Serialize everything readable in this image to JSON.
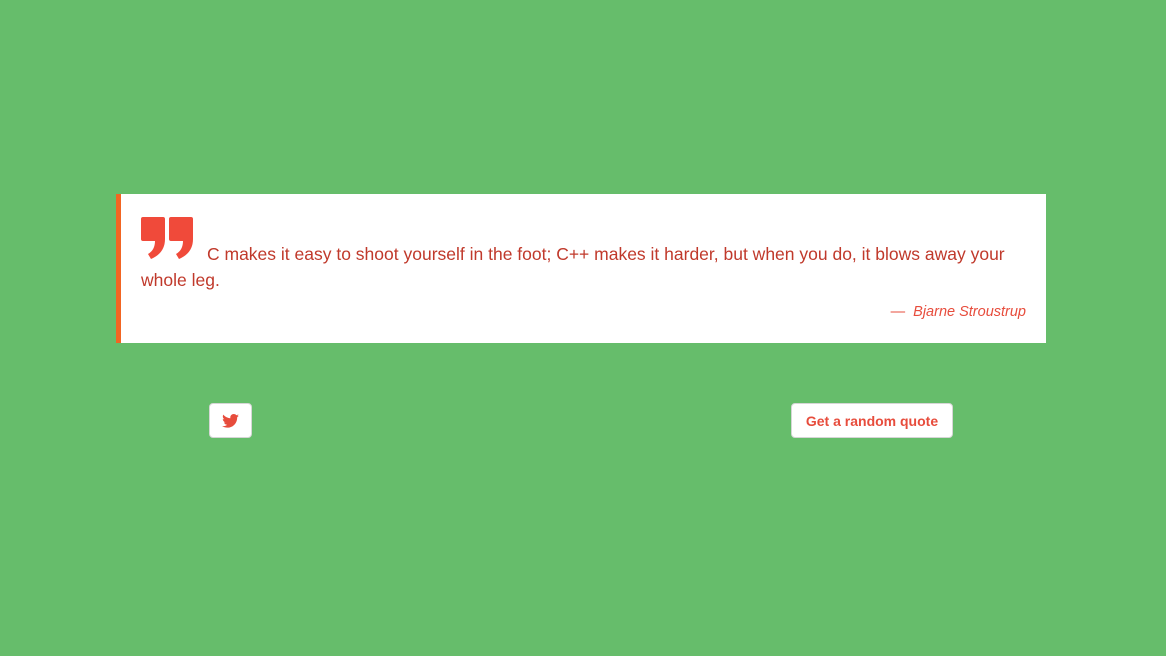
{
  "quote": {
    "icon": "quote-mark-icon",
    "text": "C makes it easy to shoot yourself in the foot; C++ makes it harder, but when you do, it blows away your whole leg.",
    "author_dash": "—",
    "author": "Bjarne Stroustrup"
  },
  "actions": {
    "tweet_icon": "twitter-icon",
    "random_label": "Get a random quote"
  },
  "colors": {
    "background": "#66bd6b",
    "card": "#ffffff",
    "accent_border": "#f26522",
    "quote_text": "#c0392b",
    "accent": "#e74c3c"
  }
}
